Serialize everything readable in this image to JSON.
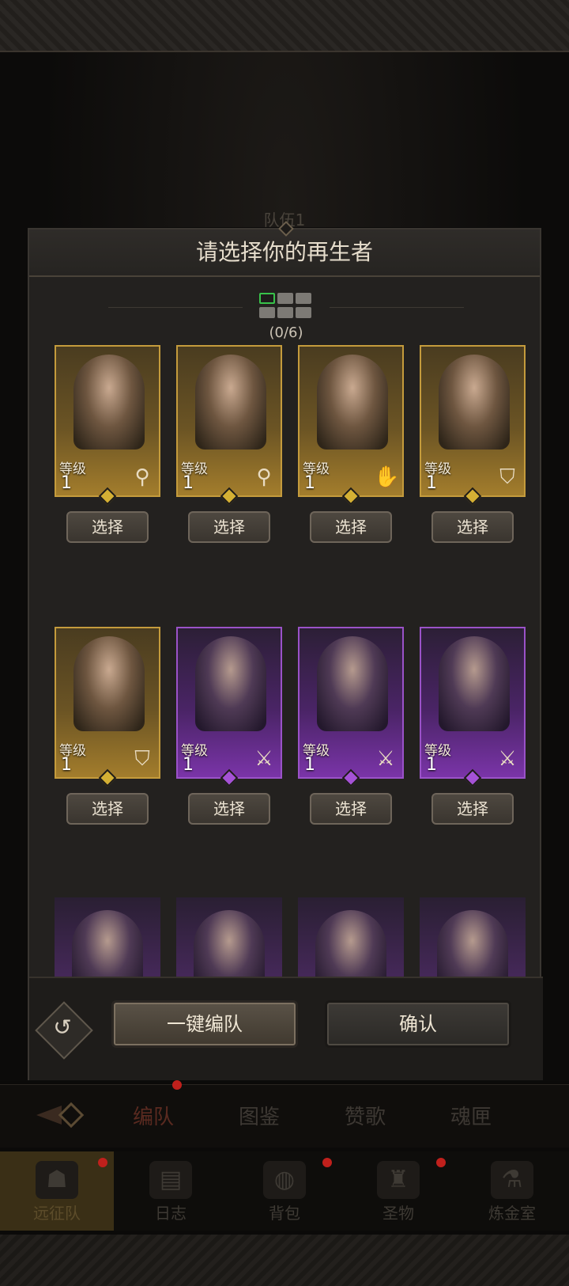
{
  "background": {
    "team_label": "队伍1"
  },
  "modal": {
    "title": "请选择你的再生者",
    "counter": "(0/6)",
    "level_label": "等级",
    "select_label": "选择",
    "rows": [
      [
        {
          "rarity": "gold",
          "level": "1",
          "class_icon": "staff-icon"
        },
        {
          "rarity": "gold",
          "level": "1",
          "class_icon": "staff-icon"
        },
        {
          "rarity": "gold",
          "level": "1",
          "class_icon": "palm-icon"
        },
        {
          "rarity": "gold",
          "level": "1",
          "class_icon": "shield-icon"
        }
      ],
      [
        {
          "rarity": "gold",
          "level": "1",
          "class_icon": "shield-icon"
        },
        {
          "rarity": "purple",
          "level": "1",
          "class_icon": "sword-icon"
        },
        {
          "rarity": "purple",
          "level": "1",
          "class_icon": "sword-icon"
        },
        {
          "rarity": "purple",
          "level": "1",
          "class_icon": "sword-icon"
        }
      ],
      [
        {
          "rarity": "purple"
        },
        {
          "rarity": "purple"
        },
        {
          "rarity": "purple"
        },
        {
          "rarity": "purple"
        }
      ]
    ],
    "auto_button": "一键编队",
    "confirm_button": "确认"
  },
  "subtabs": [
    "编队",
    "图鉴",
    "赞歌",
    "魂匣"
  ],
  "nav": [
    {
      "label": "远征队",
      "icon": "helmet-icon",
      "active": true
    },
    {
      "label": "日志",
      "icon": "scroll-icon",
      "active": false
    },
    {
      "label": "背包",
      "icon": "bag-icon",
      "active": false
    },
    {
      "label": "圣物",
      "icon": "chalice-icon",
      "active": false
    },
    {
      "label": "炼金室",
      "icon": "alchemy-icon",
      "active": false
    }
  ],
  "colors": {
    "gold_rarity": "#c49b3c",
    "purple_rarity": "#9a52c8",
    "counter_active": "#38c24a",
    "notification": "#c0201c"
  }
}
